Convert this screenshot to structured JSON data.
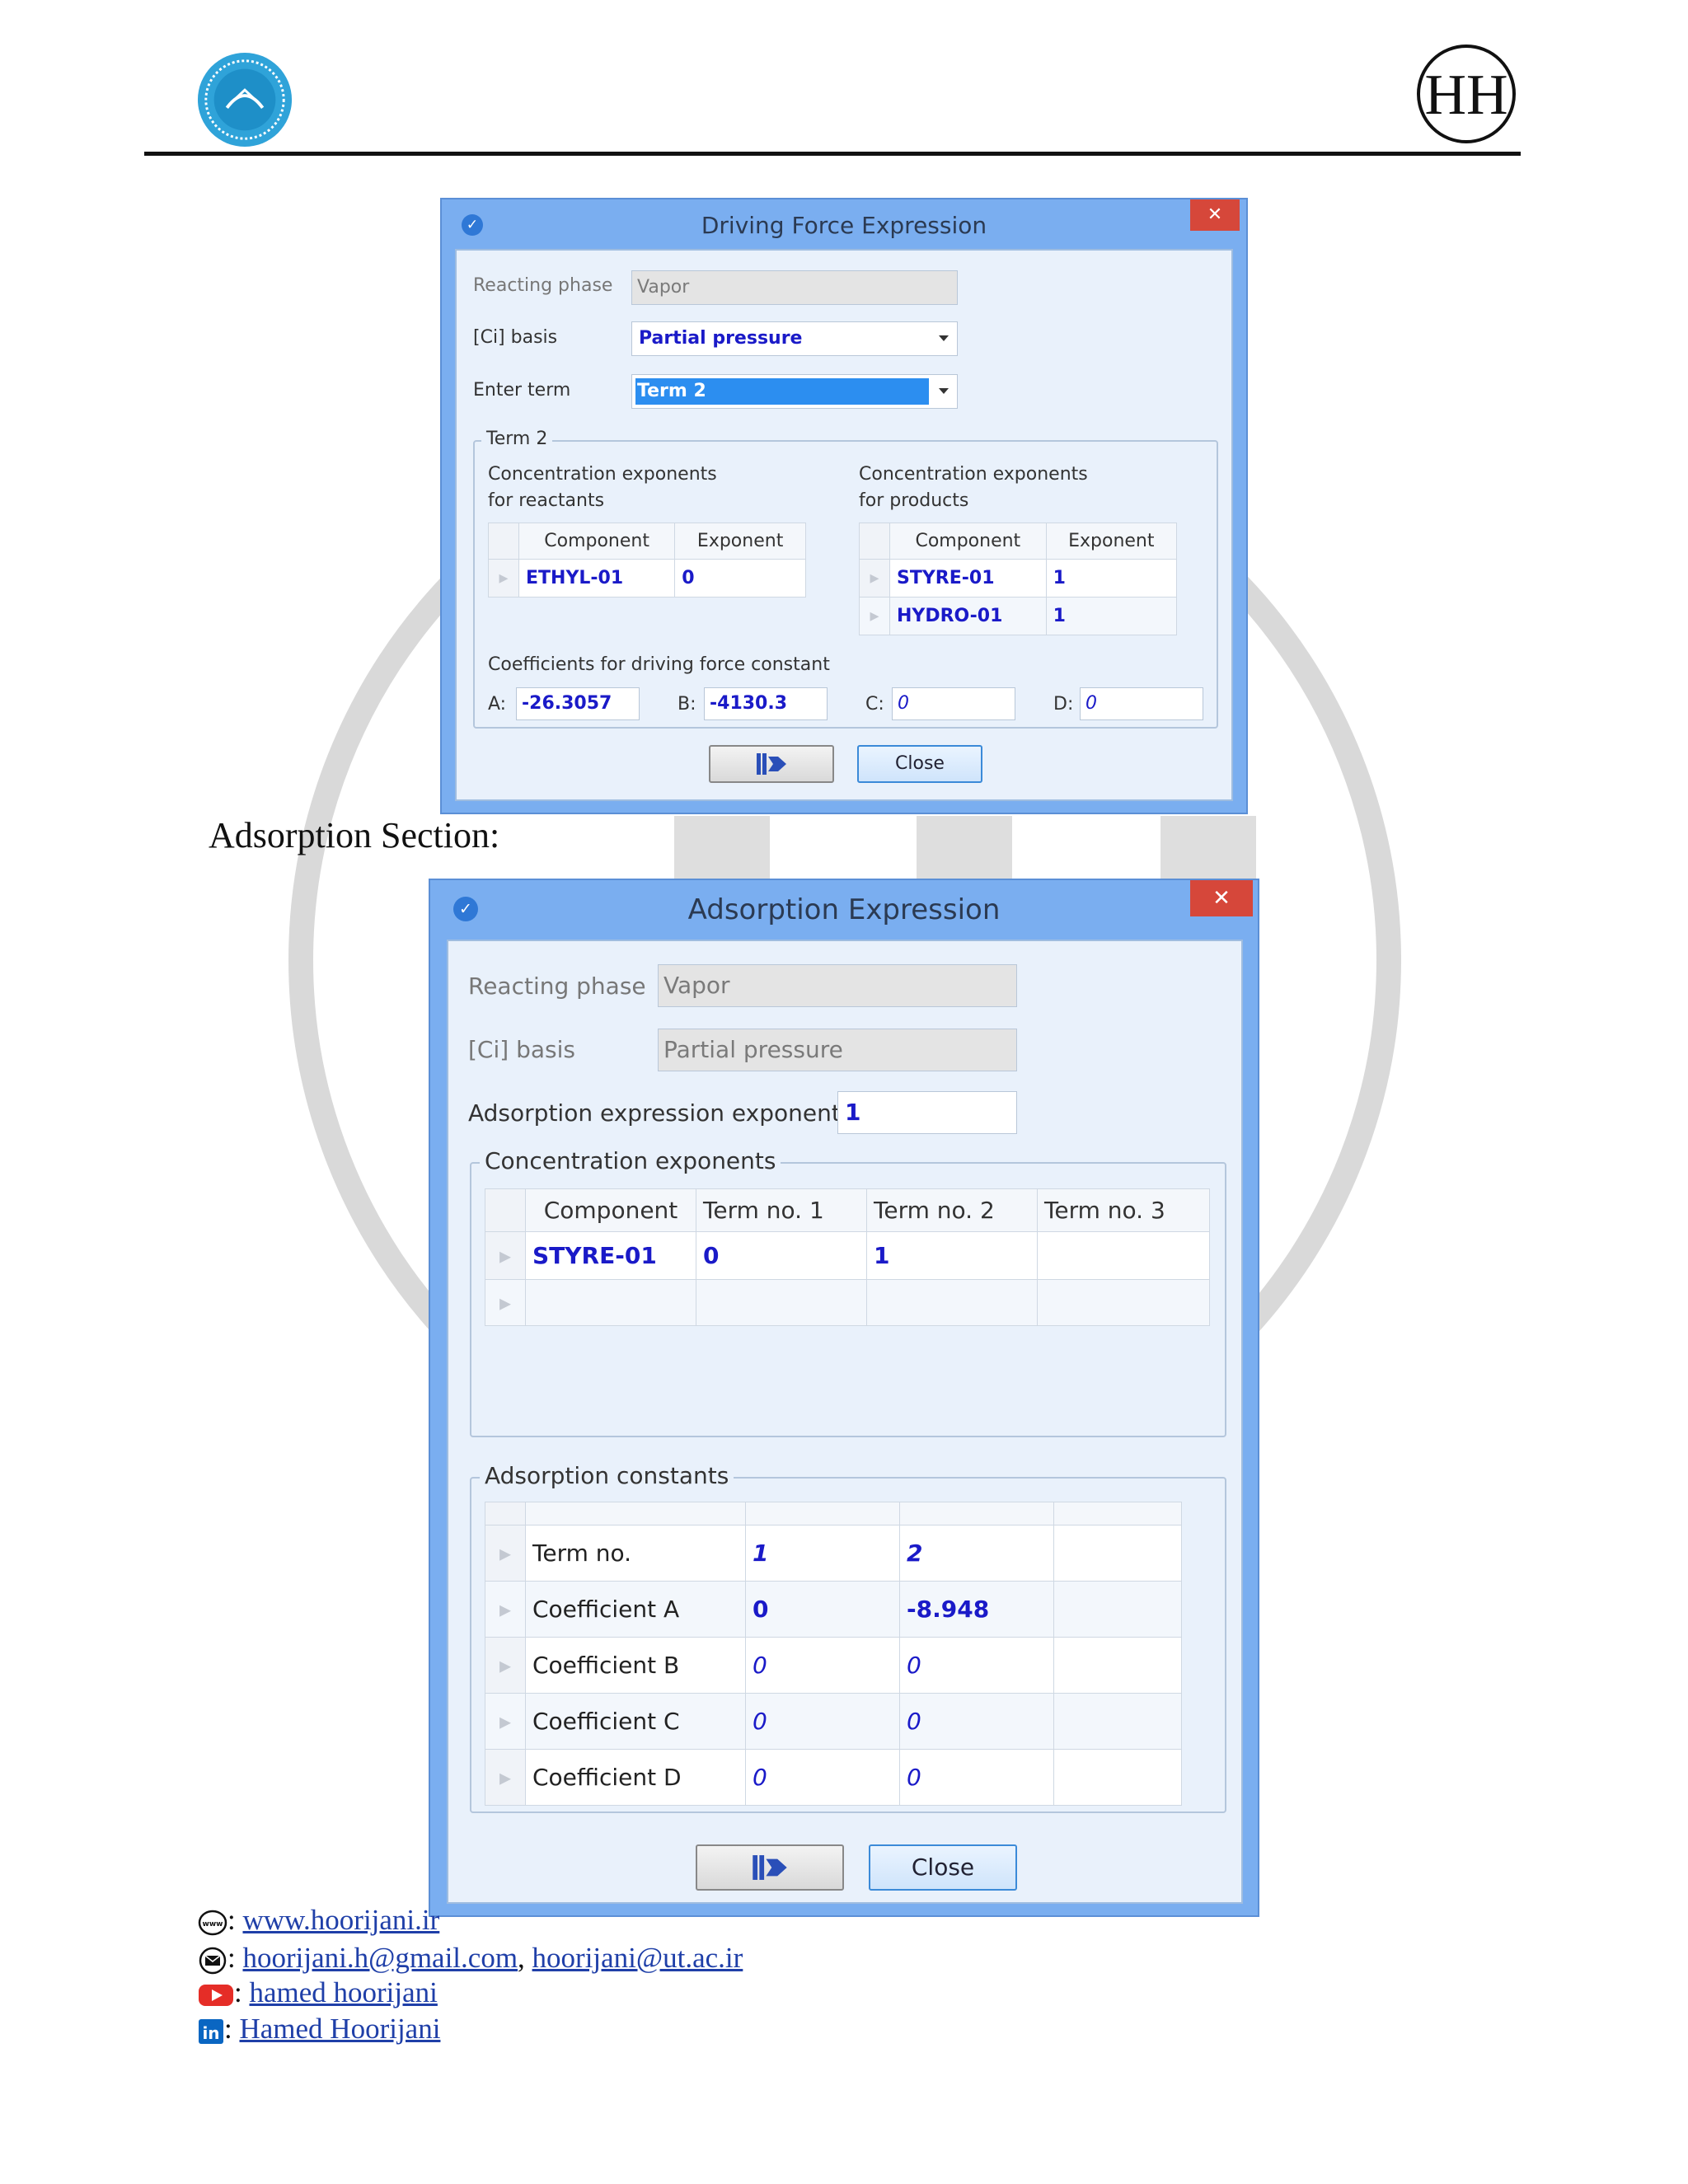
{
  "dialog1": {
    "title": "Driving Force Expression",
    "close_icon": "✕",
    "reacting_phase_label": "Reacting phase",
    "reacting_phase_value": "Vapor",
    "ci_basis_label": "[Ci] basis",
    "ci_basis_value": "Partial pressure",
    "enter_term_label": "Enter term",
    "enter_term_value": "Term 2",
    "group_label": "Term 2",
    "reactants_heading_1": "Concentration exponents",
    "reactants_heading_2": "for reactants",
    "products_heading_1": "Concentration exponents",
    "products_heading_2": "for products",
    "reactants_columns": [
      "Component",
      "Exponent"
    ],
    "reactants_rows": [
      {
        "component": "ETHYL-01",
        "exponent": "0"
      }
    ],
    "products_columns": [
      "Component",
      "Exponent"
    ],
    "products_rows": [
      {
        "component": "STYRE-01",
        "exponent": "1"
      },
      {
        "component": "HYDRO-01",
        "exponent": "1"
      }
    ],
    "coeff_heading": "Coefficients for driving force constant",
    "coeff": {
      "a_label": "A:",
      "a_value": "-26.3057",
      "b_label": "B:",
      "b_value": "-4130.3",
      "c_label": "C:",
      "c_value": "0",
      "d_label": "D:",
      "d_value": "0"
    },
    "next_button_icon": "next-arrow-icon",
    "close_button": "Close"
  },
  "section_title": "Adsorption Section:",
  "dialog2": {
    "title": "Adsorption Expression",
    "close_icon": "✕",
    "reacting_phase_label": "Reacting phase",
    "reacting_phase_value": "Vapor",
    "ci_basis_label": "[Ci] basis",
    "ci_basis_value": "Partial pressure",
    "exponent_label": "Adsorption expression exponent",
    "exponent_value": "1",
    "conc_group_label": "Concentration exponents",
    "conc_columns": [
      "Component",
      "Term no. 1",
      "Term no. 2",
      "Term no. 3"
    ],
    "conc_rows": [
      {
        "component": "STYRE-01",
        "t1": "0",
        "t2": "1",
        "t3": ""
      }
    ],
    "ads_group_label": "Adsorption constants",
    "ads_rows": [
      {
        "label": "Term no.",
        "v1": "1",
        "v2": "2"
      },
      {
        "label": "Coefficient A",
        "v1": "0",
        "v2": "-8.948"
      },
      {
        "label": "Coefficient B",
        "v1": "0",
        "v2": "0"
      },
      {
        "label": "Coefficient C",
        "v1": "0",
        "v2": "0"
      },
      {
        "label": "Coefficient D",
        "v1": "0",
        "v2": "0"
      }
    ],
    "close_button": "Close"
  },
  "footer": {
    "sep": ":",
    "website": "www.hoorijani.ir",
    "email1": "hoorijani.h@gmail.com",
    "email_sep": ",",
    "email2": "hoorijani@ut.ac.ir",
    "youtube": "hamed hoorijani",
    "linkedin": "Hamed Hoorijani",
    "icons": [
      "globe-icon",
      "envelope-icon",
      "youtube-icon",
      "linkedin-icon"
    ]
  },
  "header": {
    "logo_left": "university-of-tehran-logo",
    "logo_right": "hh-monogram-logo",
    "logo_right_text": "HH"
  }
}
